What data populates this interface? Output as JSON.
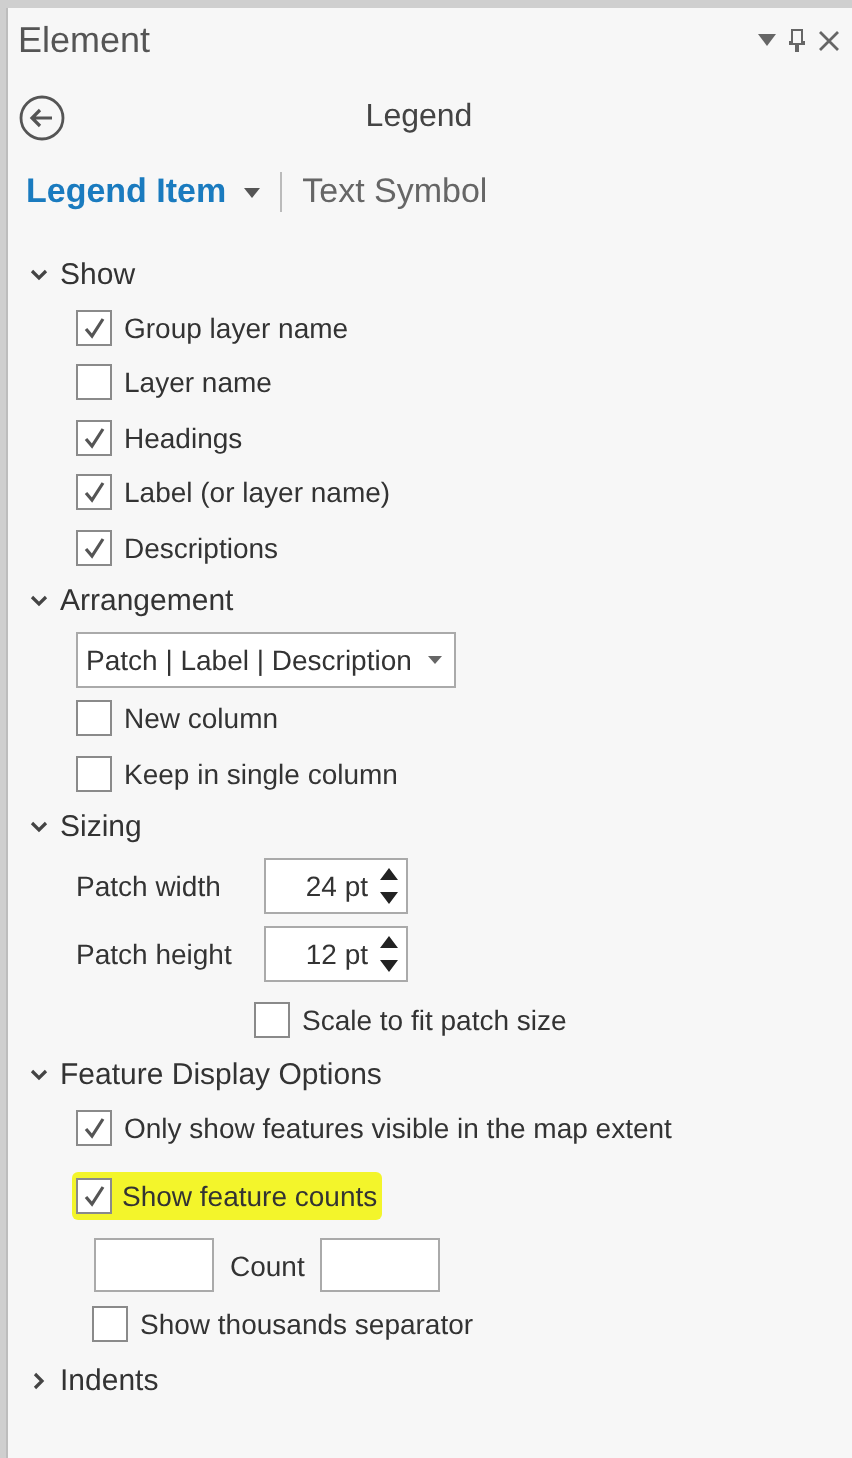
{
  "window": {
    "title": "Element"
  },
  "header": {
    "title": "Legend"
  },
  "tabs": [
    {
      "label": "Legend Item",
      "selected": true,
      "has_menu": true
    },
    {
      "label": "Text Symbol",
      "selected": false,
      "has_menu": false
    }
  ],
  "sections": [
    {
      "title": "Show",
      "expanded": true,
      "items": [
        {
          "kind": "checkbox",
          "label": "Group layer name",
          "checked": true
        },
        {
          "kind": "checkbox",
          "label": "Layer name",
          "checked": false
        },
        {
          "kind": "checkbox",
          "label": "Headings",
          "checked": true
        },
        {
          "kind": "checkbox",
          "label": "Label (or layer name)",
          "checked": true
        },
        {
          "kind": "checkbox",
          "label": "Descriptions",
          "checked": true
        }
      ]
    },
    {
      "title": "Arrangement",
      "expanded": true,
      "items": [
        {
          "kind": "dropdown",
          "value": "Patch | Label | Description"
        },
        {
          "kind": "checkbox",
          "label": "New column",
          "checked": false
        },
        {
          "kind": "checkbox",
          "label": "Keep in single column",
          "checked": false
        }
      ]
    },
    {
      "title": "Sizing",
      "expanded": true,
      "items": [
        {
          "kind": "spin",
          "label": "Patch width",
          "value": "24 pt"
        },
        {
          "kind": "spin",
          "label": "Patch height",
          "value": "12 pt"
        },
        {
          "kind": "aligned-checkbox",
          "label": "Scale to fit patch size",
          "checked": false
        }
      ]
    },
    {
      "title": "Feature Display Options",
      "expanded": true,
      "items": [
        {
          "kind": "checkbox",
          "label": "Only show features visible in the map extent",
          "checked": true
        },
        {
          "kind": "highlighted-checkbox",
          "label": "Show feature counts",
          "checked": true
        },
        {
          "kind": "range",
          "label": "Count"
        },
        {
          "kind": "nested-checkbox",
          "label": "Show thousands separator",
          "checked": false
        }
      ]
    },
    {
      "title": "Indents",
      "expanded": false
    }
  ]
}
